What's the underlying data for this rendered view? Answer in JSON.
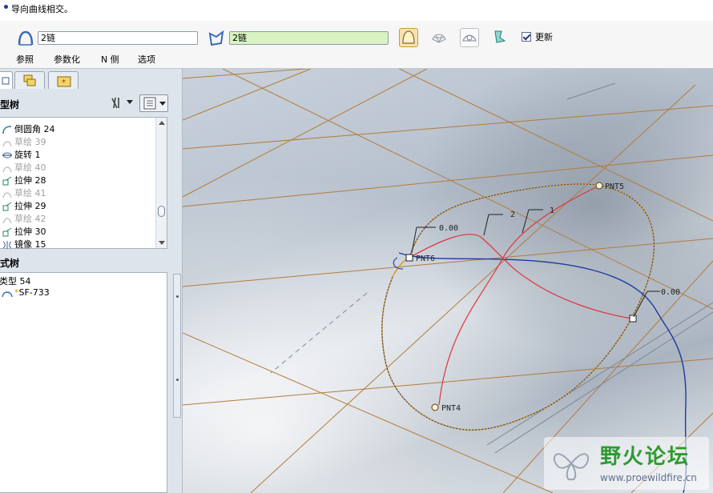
{
  "message": "导向曲线相交。",
  "dashboard": {
    "field1": "2链",
    "field2": "2链",
    "update_label": "更新",
    "update_checked": true,
    "tabs": [
      "参照",
      "参数化",
      "N 侧",
      "选项"
    ]
  },
  "navigator": {
    "model_tree_title": "型树",
    "items": [
      {
        "label": "倒圆角 24",
        "dim": false
      },
      {
        "label": "草绘 39",
        "dim": true
      },
      {
        "label": "旋转 1",
        "dim": false
      },
      {
        "label": "草绘 40",
        "dim": true
      },
      {
        "label": "拉伸 28",
        "dim": false
      },
      {
        "label": "草绘 41",
        "dim": true
      },
      {
        "label": "拉伸 29",
        "dim": false
      },
      {
        "label": "草绘 42",
        "dim": true
      },
      {
        "label": "拉伸 30",
        "dim": false
      },
      {
        "label": "镜像 15",
        "dim": false
      }
    ],
    "style_tree_title": "式树",
    "style_items": [
      "类型 54",
      "SF-733"
    ]
  },
  "viewport": {
    "points": [
      "PNT5",
      "PNT6",
      "PNT4"
    ],
    "dims": [
      "0.00",
      "0.00"
    ],
    "curve_labels": [
      "2",
      "1"
    ]
  },
  "watermark": {
    "title": "野火论坛",
    "url": "www.proewildfire.cn"
  }
}
